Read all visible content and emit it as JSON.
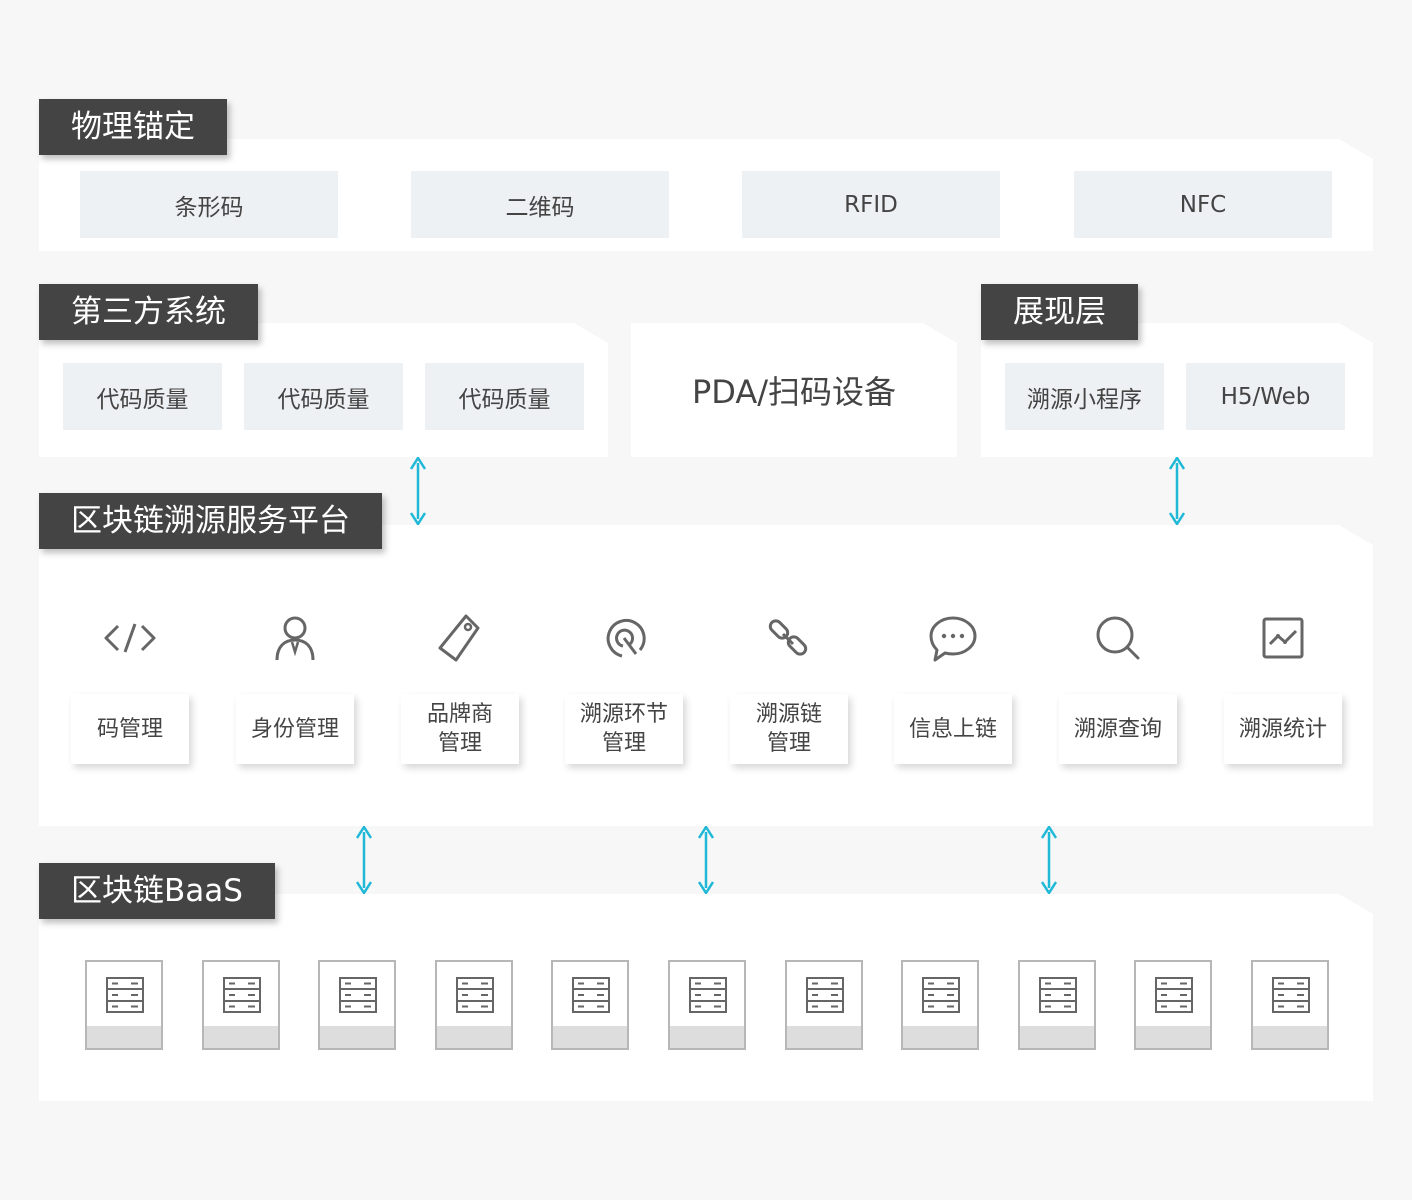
{
  "sections": {
    "physical": {
      "title": "物理锚定",
      "items": [
        "条形码",
        "二维码",
        "RFID",
        "NFC"
      ]
    },
    "third_party": {
      "title": "第三方系统",
      "items": [
        "代码质量",
        "代码质量",
        "代码质量"
      ]
    },
    "device": {
      "label": "PDA/扫码设备"
    },
    "presentation": {
      "title": "展现层",
      "items": [
        "溯源小程序",
        "H5/Web"
      ]
    },
    "platform": {
      "title": "区块链溯源服务平台",
      "modules": [
        {
          "label": "码管理",
          "icon": "code-icon"
        },
        {
          "label": "身份管理",
          "icon": "user-icon"
        },
        {
          "label": "品牌商\n管理",
          "icon": "tag-icon"
        },
        {
          "label": "溯源环节\n管理",
          "icon": "target-icon"
        },
        {
          "label": "溯源链\n管理",
          "icon": "link-icon"
        },
        {
          "label": "信息上链",
          "icon": "chat-icon"
        },
        {
          "label": "溯源查询",
          "icon": "search-icon"
        },
        {
          "label": "溯源统计",
          "icon": "chart-icon"
        }
      ]
    },
    "baas": {
      "title": "区块链BaaS",
      "nodes": 11,
      "node_icon": "server-icon"
    }
  },
  "colors": {
    "tag_bg": "#444444",
    "chip_bg": "#eef1f3",
    "arrow": "#1fb8d6",
    "icon": "#666666",
    "page_bg": "#f7f7f7"
  }
}
